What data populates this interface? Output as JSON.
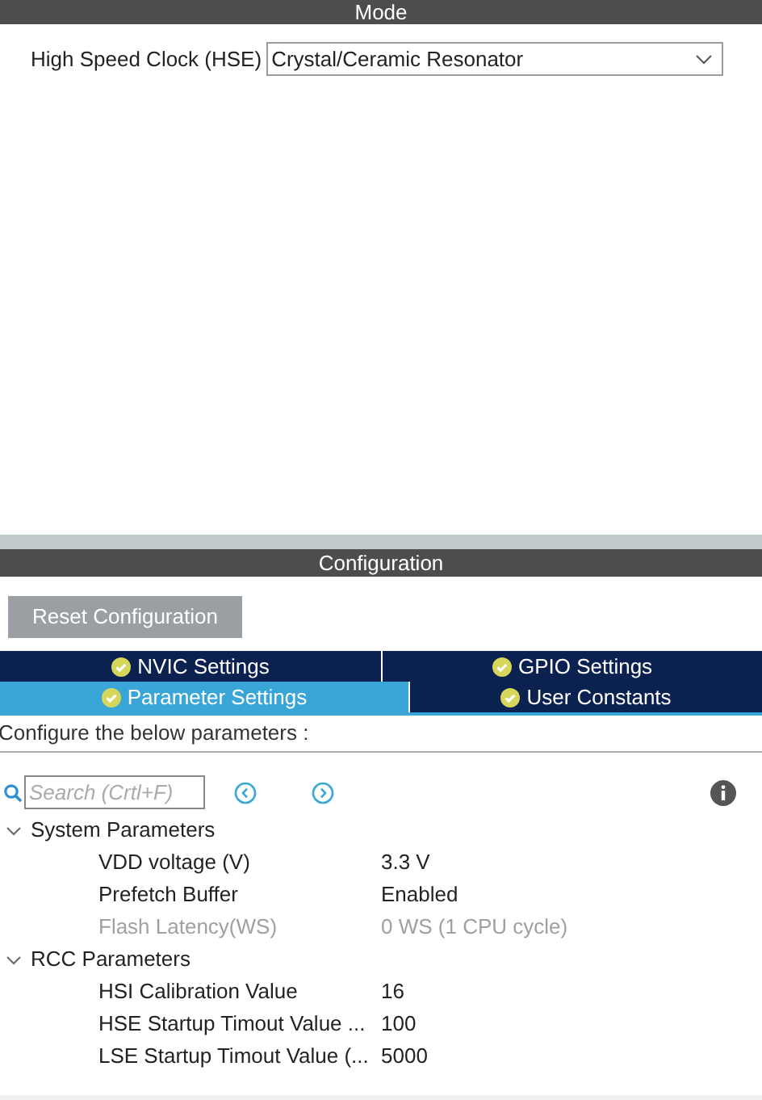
{
  "mode": {
    "title": "Mode",
    "hse": {
      "label": "High Speed Clock (HSE)",
      "value": "Crystal/Ceramic Resonator"
    }
  },
  "configuration": {
    "title": "Configuration",
    "reset_button": "Reset Configuration",
    "tab_rows": [
      [
        {
          "label": "NVIC Settings",
          "selected": false
        },
        {
          "label": "GPIO Settings",
          "selected": false
        }
      ],
      [
        {
          "label": "Parameter Settings",
          "selected": true
        },
        {
          "label": "User Constants",
          "selected": false
        }
      ]
    ],
    "hint": "Configure the below parameters :",
    "search": {
      "placeholder": "Search (Crtl+F)"
    },
    "tree": [
      {
        "label": "System Parameters",
        "expanded": true,
        "children": [
          {
            "label": "VDD voltage (V)",
            "value": "3.3 V",
            "disabled": false
          },
          {
            "label": "Prefetch Buffer",
            "value": "Enabled",
            "disabled": false
          },
          {
            "label": "Flash Latency(WS)",
            "value": "0 WS (1 CPU cycle)",
            "disabled": true
          }
        ]
      },
      {
        "label": "RCC Parameters",
        "expanded": true,
        "children": [
          {
            "label": "HSI Calibration Value",
            "value": "16",
            "disabled": false
          },
          {
            "label": "HSE Startup Timout Value ...",
            "value": "100",
            "disabled": false
          },
          {
            "label": "LSE Startup Timout Value (...",
            "value": "5000",
            "disabled": false
          }
        ]
      }
    ]
  }
}
